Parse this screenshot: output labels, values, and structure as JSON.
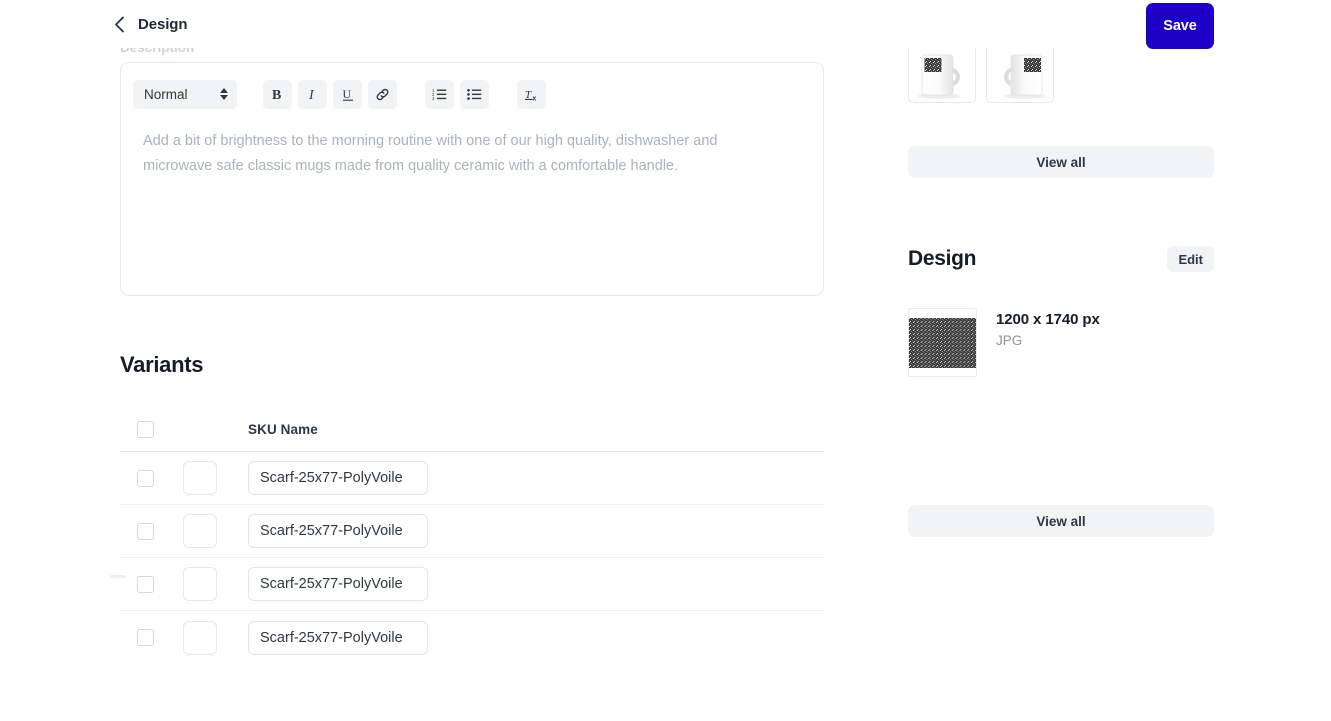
{
  "header": {
    "back_icon": "chevron-left-icon",
    "title": "Design",
    "save_label": "Save",
    "save_color": "#1d00c8"
  },
  "description": {
    "label": "Description",
    "toolbar": {
      "style_select_value": "Normal",
      "buttons": [
        {
          "name": "bold-icon",
          "glyph": "B"
        },
        {
          "name": "italic-icon",
          "glyph": "I"
        },
        {
          "name": "underline-icon",
          "glyph": "U"
        },
        {
          "name": "link-icon",
          "glyph": "link"
        },
        {
          "name": "ordered-list-icon",
          "glyph": "ol"
        },
        {
          "name": "bullet-list-icon",
          "glyph": "ul"
        },
        {
          "name": "clear-formatting-icon",
          "glyph": "Tx"
        }
      ]
    },
    "placeholder": "Add a bit of brightness to the morning routine with one of our high quality, dishwasher and microwave safe classic mugs made from quality ceramic with a comfortable handle.",
    "value": ""
  },
  "variants": {
    "title": "Variants",
    "columns": [
      "",
      "",
      "SKU Name"
    ],
    "sku_column_label": "SKU Name",
    "select_all_checked": false,
    "rows": [
      {
        "checked": false,
        "thumbnail": "",
        "sku": "Scarf-25x77-PolyVoile"
      },
      {
        "checked": false,
        "thumbnail": "",
        "sku": "Scarf-25x77-PolyVoile"
      },
      {
        "checked": false,
        "thumbnail": "",
        "sku": "Scarf-25x77-PolyVoile"
      },
      {
        "checked": false,
        "thumbnail": "",
        "sku": "Scarf-25x77-PolyVoile"
      }
    ]
  },
  "sidebar": {
    "mockups": {
      "items": [
        {
          "name": "mug-mockup-handle-right"
        },
        {
          "name": "mug-mockup-handle-left"
        }
      ],
      "view_all_label": "View all"
    },
    "design": {
      "title": "Design",
      "edit_label": "Edit",
      "file": {
        "dimensions": "1200 x 1740 px",
        "format": "JPG"
      },
      "view_all_label": "View all"
    }
  }
}
